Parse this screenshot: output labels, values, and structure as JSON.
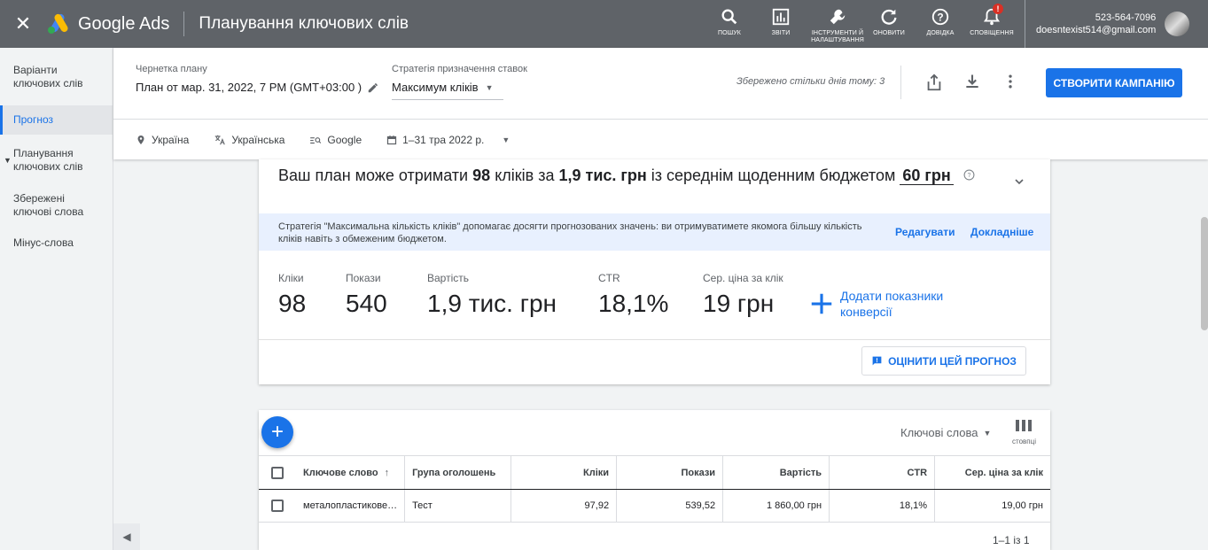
{
  "topbar": {
    "close_icon": "close-icon",
    "product": "Google Ads",
    "title": "Планування ключових слів",
    "actions": [
      {
        "icon": "search-icon",
        "label": "ПОШУК"
      },
      {
        "icon": "bar-chart-icon",
        "label": "ЗВІТИ"
      },
      {
        "icon": "wrench-icon",
        "label": "ІНСТРУМЕНТИ Й НАЛАШТУВАННЯ"
      },
      {
        "icon": "refresh-icon",
        "label": "ОНОВИТИ"
      },
      {
        "icon": "help-icon",
        "label": "ДОВІДКА"
      },
      {
        "icon": "bell-icon",
        "label": "СПОВІЩЕННЯ",
        "badge": "!"
      }
    ],
    "account": {
      "phone": "523-564-7096",
      "email": "doesntexist514@gmail.com"
    }
  },
  "sidebar": {
    "items": [
      {
        "label": "Варіанти ключових слів"
      },
      {
        "label": "Прогноз"
      },
      {
        "label": "Планування ключових слів"
      },
      {
        "label": "Збережені ключові слова"
      },
      {
        "label": "Мінус-слова"
      }
    ],
    "collapse_icon": "chevron-left-icon"
  },
  "plan": {
    "draft_label": "Чернетка плану",
    "draft_value": "План от мар. 31, 2022, 7 PM (GMT+03:00 )",
    "strategy_label": "Стратегія призначення ставок",
    "strategy_value": "Максимум кліків",
    "saved_text": "Збережено стільки днів тому: 3",
    "create_button": "СТВОРИТИ КАМПАНІЮ",
    "filters": {
      "location": "Україна",
      "language": "Українська",
      "network": "Google",
      "date_range": "1–31 тра 2022 р."
    }
  },
  "forecast": {
    "headline_pre": "Ваш план може отримати",
    "clicks_strong": "98",
    "headline_mid1": "кліків за",
    "cost_strong": "1,9 тис. грн",
    "headline_mid2": "із середнім щоденним бюджетом",
    "budget": "60 грн",
    "info_text": "Стратегія \"Максимальна кількість кліків\" допомагає досягти прогнозованих значень: ви отримуватимете якомога більшу кількість кліків навіть з обмеженим бюджетом.",
    "edit_link": "Редагувати",
    "more_link": "Докладніше",
    "metrics": [
      {
        "label": "Кліки",
        "value": "98"
      },
      {
        "label": "Покази",
        "value": "540"
      },
      {
        "label": "Вартість",
        "value": "1,9 тис. грн"
      },
      {
        "label": "CTR",
        "value": "18,1%"
      },
      {
        "label": "Сер. ціна за клік",
        "value": "19 грн"
      }
    ],
    "add_conversions": "Додати показники конверсії",
    "rate_button": "ОЦІНИТИ ЦЕЙ ПРОГНОЗ"
  },
  "table": {
    "view_select": "Ключові слова",
    "columns_label": "стовпці",
    "headers": [
      "Ключове слово",
      "Група оголошень",
      "Кліки",
      "Покази",
      "Вартість",
      "CTR",
      "Сер. ціна за клік"
    ],
    "rows": [
      {
        "keyword": "металопластикове…",
        "group": "Тест",
        "clicks": "97,92",
        "impressions": "539,52",
        "cost": "1 860,00 грн",
        "ctr": "18,1%",
        "cpc": "19,00 грн"
      }
    ],
    "pager": "1–1 із 1"
  }
}
